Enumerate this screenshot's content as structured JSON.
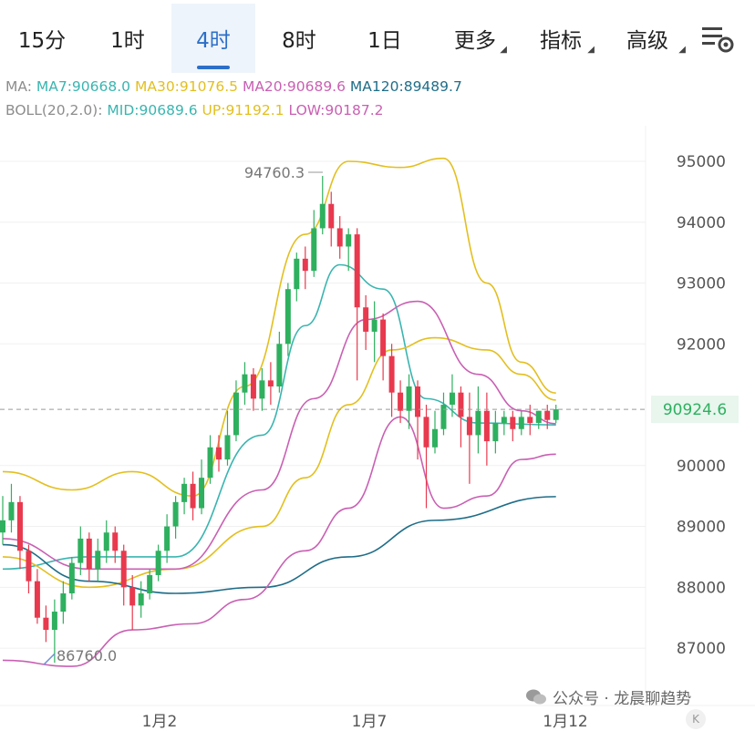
{
  "toolbar": {
    "tabs": [
      {
        "label": "15分",
        "active": false
      },
      {
        "label": "1时",
        "active": false
      },
      {
        "label": "4时",
        "active": true
      },
      {
        "label": "8时",
        "active": false
      },
      {
        "label": "1日",
        "active": false
      }
    ],
    "more_label": "更多",
    "indicators_label": "指标",
    "advanced_label": "高级",
    "settings_icon": "chart-settings-icon",
    "accent_color": "#2c6fc9"
  },
  "legend": {
    "ma_prefix": "MA:",
    "ma7": "MA7:90668.0",
    "ma30": "MA30:91076.5",
    "ma20": "MA20:90689.6",
    "ma120": "MA120:89489.7",
    "boll_prefix": "BOLL(20,2.0):",
    "mid": "MID:90689.6",
    "up": "UP:91192.1",
    "low": "LOW:90187.2",
    "colors": {
      "ma7": "#3ab5b0",
      "ma30": "#e3bf1f",
      "ma20": "#c960b3",
      "ma120": "#1f6d88"
    }
  },
  "chart_data": {
    "type": "line",
    "title": "",
    "y_ticks": [
      "95000",
      "94000",
      "93000",
      "92000",
      "90000",
      "89000",
      "88000",
      "87000"
    ],
    "x_ticks": [
      "1月2",
      "1月7",
      "1月12"
    ],
    "ylim": [
      86700,
      95500
    ],
    "current_price": "90924.6",
    "high_label": "94760.3",
    "low_label": "86760.0",
    "colors": {
      "up": "#2eb05f",
      "down": "#e8394e",
      "ma7": "#3ab5b0",
      "ma30": "#e3bf1f",
      "ma20": "#c960b3",
      "ma120": "#1f6d88",
      "price_line": "#9a9a9a",
      "price_label_bg": "#e8f6ee",
      "price_label": "#2eb05f"
    },
    "candles": [
      [
        88900,
        89100,
        89500,
        88700
      ],
      [
        89100,
        89400,
        89700,
        88900
      ],
      [
        89400,
        88600,
        89500,
        88300
      ],
      [
        88600,
        88100,
        88700,
        87900
      ],
      [
        88100,
        87500,
        88300,
        87400
      ],
      [
        87500,
        87300,
        87700,
        87100
      ],
      [
        87300,
        87600,
        87800,
        86760
      ],
      [
        87600,
        87900,
        88100,
        87400
      ],
      [
        87900,
        88400,
        88500,
        87800
      ],
      [
        88400,
        88800,
        89000,
        88200
      ],
      [
        88800,
        88300,
        88900,
        88100
      ],
      [
        88300,
        88600,
        88800,
        88100
      ],
      [
        88600,
        88900,
        89100,
        88400
      ],
      [
        88900,
        88600,
        89000,
        88400
      ],
      [
        88600,
        88000,
        88700,
        87700
      ],
      [
        88000,
        87700,
        88200,
        87300
      ],
      [
        87700,
        87900,
        88100,
        87500
      ],
      [
        87900,
        88200,
        88300,
        87800
      ],
      [
        88200,
        88600,
        88700,
        88100
      ],
      [
        88600,
        89000,
        89200,
        88400
      ],
      [
        89000,
        89400,
        89500,
        88800
      ],
      [
        89400,
        89700,
        89800,
        89200
      ],
      [
        89700,
        89300,
        89900,
        89100
      ],
      [
        89300,
        89800,
        90100,
        89200
      ],
      [
        89800,
        90300,
        90500,
        89700
      ],
      [
        90300,
        90100,
        90500,
        89900
      ],
      [
        90100,
        90500,
        90900,
        90000
      ],
      [
        90500,
        91200,
        91400,
        90400
      ],
      [
        91200,
        91500,
        91700,
        91000
      ],
      [
        91500,
        91100,
        91600,
        90900
      ],
      [
        91100,
        91400,
        91600,
        90900
      ],
      [
        91400,
        91300,
        91700,
        91000
      ],
      [
        91300,
        92000,
        92200,
        91200
      ],
      [
        92000,
        92900,
        93000,
        91800
      ],
      [
        92900,
        93400,
        93500,
        92700
      ],
      [
        93400,
        93200,
        93600,
        92900
      ],
      [
        93200,
        93900,
        94200,
        93100
      ],
      [
        93900,
        94300,
        94760,
        93800
      ],
      [
        94300,
        93900,
        94500,
        93600
      ],
      [
        93900,
        93600,
        94100,
        93400
      ],
      [
        93600,
        93800,
        93900,
        93200
      ],
      [
        93800,
        92600,
        93900,
        91400
      ],
      [
        92600,
        92200,
        92800,
        91900
      ],
      [
        92200,
        92400,
        92700,
        91700
      ],
      [
        92400,
        91800,
        92500,
        91400
      ],
      [
        91800,
        91200,
        92000,
        90800
      ],
      [
        91200,
        90900,
        91400,
        90700
      ],
      [
        90900,
        91300,
        91500,
        90600
      ],
      [
        91300,
        90800,
        91400,
        90100
      ],
      [
        90800,
        90300,
        91000,
        89300
      ],
      [
        90300,
        90600,
        90900,
        90200
      ],
      [
        90600,
        91000,
        91200,
        90500
      ],
      [
        91000,
        91200,
        91500,
        90800
      ],
      [
        91200,
        90800,
        91300,
        90300
      ],
      [
        90800,
        90500,
        91200,
        89700
      ],
      [
        90500,
        90900,
        91300,
        90200
      ],
      [
        90900,
        90400,
        91200,
        90000
      ],
      [
        90400,
        90700,
        90900,
        90200
      ],
      [
        90700,
        90800,
        90900,
        90500
      ],
      [
        90800,
        90600,
        90900,
        90400
      ],
      [
        90600,
        90800,
        90900,
        90500
      ],
      [
        90800,
        90700,
        91000,
        90500
      ],
      [
        90700,
        90900,
        90900,
        90600
      ],
      [
        90900,
        90750,
        91000,
        90600
      ],
      [
        90750,
        90924.6,
        91000,
        90700
      ]
    ],
    "series": [
      {
        "name": "MA7",
        "values": [
          [
            0,
            88300
          ],
          [
            10,
            88500
          ],
          [
            20,
            88500
          ],
          [
            30,
            90500
          ],
          [
            35,
            92300
          ],
          [
            39,
            93300
          ],
          [
            44,
            92900
          ],
          [
            49,
            91100
          ],
          [
            55,
            90700
          ],
          [
            64,
            90668
          ]
        ]
      },
      {
        "name": "MA30",
        "values": [
          [
            0,
            88500
          ],
          [
            10,
            88000
          ],
          [
            20,
            88300
          ],
          [
            30,
            89000
          ],
          [
            35,
            89800
          ],
          [
            40,
            91000
          ],
          [
            45,
            91900
          ],
          [
            50,
            92100
          ],
          [
            56,
            91900
          ],
          [
            60,
            91500
          ],
          [
            64,
            91076.5
          ]
        ]
      },
      {
        "name": "MA20",
        "values": [
          [
            0,
            88800
          ],
          [
            10,
            88300
          ],
          [
            20,
            88300
          ],
          [
            30,
            89600
          ],
          [
            36,
            91100
          ],
          [
            42,
            92400
          ],
          [
            48,
            92700
          ],
          [
            55,
            91500
          ],
          [
            60,
            90900
          ],
          [
            64,
            90689.6
          ]
        ]
      },
      {
        "name": "MA120",
        "values": [
          [
            0,
            88700
          ],
          [
            10,
            88100
          ],
          [
            20,
            87900
          ],
          [
            30,
            88000
          ],
          [
            40,
            88500
          ],
          [
            50,
            89100
          ],
          [
            64,
            89489.7
          ]
        ]
      },
      {
        "name": "UP",
        "values": [
          [
            0,
            89900
          ],
          [
            8,
            89600
          ],
          [
            15,
            89900
          ],
          [
            22,
            89500
          ],
          [
            28,
            91300
          ],
          [
            35,
            93800
          ],
          [
            40,
            95000
          ],
          [
            46,
            94900
          ],
          [
            51,
            95050
          ],
          [
            56,
            93000
          ],
          [
            60,
            91700
          ],
          [
            64,
            91192.1
          ]
        ]
      },
      {
        "name": "LOW",
        "values": [
          [
            0,
            86800
          ],
          [
            8,
            86700
          ],
          [
            15,
            87300
          ],
          [
            22,
            87400
          ],
          [
            28,
            87800
          ],
          [
            35,
            88600
          ],
          [
            40,
            89300
          ],
          [
            46,
            90800
          ],
          [
            51,
            89300
          ],
          [
            56,
            89500
          ],
          [
            60,
            90100
          ],
          [
            64,
            90187.2
          ]
        ]
      }
    ]
  },
  "watermark": {
    "text": "公众号 · 龙晨聊趋势",
    "icon": "wechat-icon"
  },
  "corner_badge": "K"
}
